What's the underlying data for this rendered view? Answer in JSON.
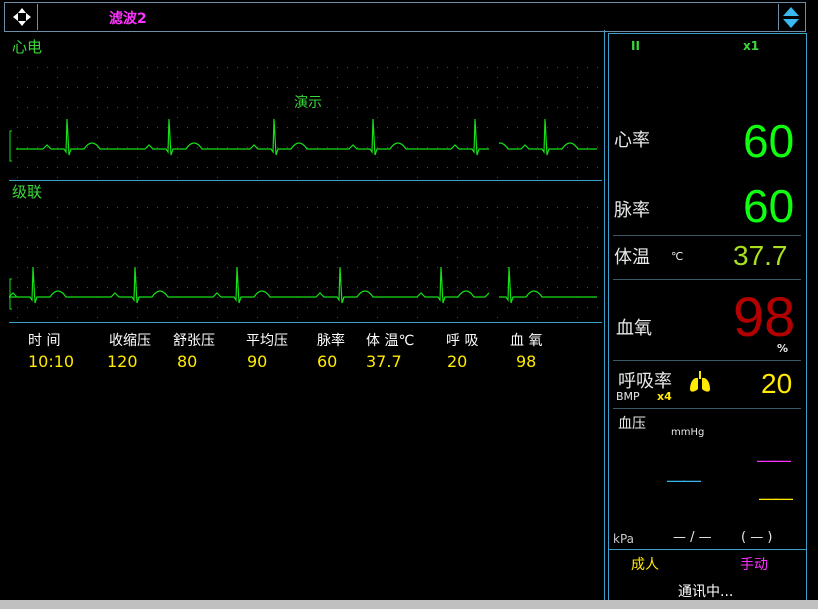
{
  "topbar": {
    "filter_label": "滤波2",
    "move_icon": "move-arrows-icon",
    "spin_icon": "up-down-spinner-icon"
  },
  "ecg": {
    "lead1_label": "心电",
    "demo_label": "演示",
    "lead2_label": "级联"
  },
  "table": {
    "headers": [
      "时 间",
      "收缩压",
      "舒张压",
      "平均压",
      "脉率",
      "体 温℃",
      "呼 吸",
      "血 氧"
    ],
    "values": [
      "10:10",
      "120",
      "80",
      "90",
      "60",
      "37.7",
      "20",
      "98"
    ]
  },
  "vitals": {
    "lead": "II",
    "gain": "x1",
    "hr_label": "心率",
    "hr_value": "60",
    "pr_label": "脉率",
    "pr_value": "60",
    "temp_label": "体温",
    "temp_unit": "℃",
    "temp_value": "37.7",
    "spo2_label": "血氧",
    "spo2_value": "98",
    "spo2_unit": "%",
    "resp_label": "呼吸率",
    "resp_unit": "BMP",
    "resp_gain": "x4",
    "resp_value": "20",
    "resp_icon": "lungs-icon",
    "bp_label": "血压",
    "bp_unit": "mmHg",
    "bp_sys": "——",
    "bp_mean": "——",
    "bp_dia": "——",
    "kpa_label": "kPa",
    "kpa_value": "— / —",
    "kpa_paren": "(  —  )",
    "patient_type": "成人",
    "mode": "手动",
    "status": "通讯中..."
  },
  "colors": {
    "wave": "#16e016",
    "hr": "#10ff10",
    "spo2": "#b30000",
    "yellow": "#ffea00",
    "magenta": "#ff33ff",
    "cyan": "#3ab8f0",
    "border": "#3aa0c8"
  }
}
